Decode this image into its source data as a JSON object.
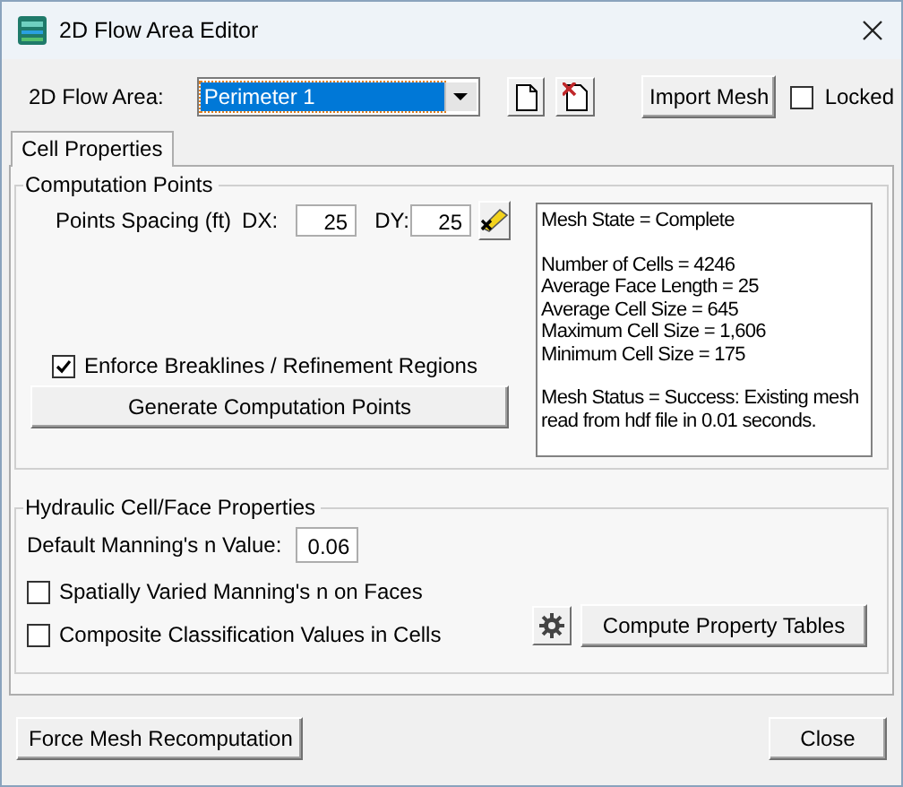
{
  "window": {
    "title": "2D Flow Area Editor"
  },
  "flow_area": {
    "label": "2D Flow Area:",
    "value": "Perimeter 1"
  },
  "import_button": "Import Mesh",
  "locked": {
    "label": "Locked",
    "checked": false
  },
  "tabs": [
    {
      "label": "Cell Properties",
      "selected": true
    }
  ],
  "computation_points": {
    "title": "Computation Points",
    "spacing_label": "Points Spacing (ft)",
    "dx_label": "DX:",
    "dx_value": "25",
    "dy_label": "DY:",
    "dy_value": "25",
    "enforce": {
      "label": "Enforce Breaklines / Refinement Regions",
      "checked": true
    },
    "generate_button": "Generate Computation Points",
    "mesh_info": [
      [
        "Mesh State = Complete"
      ],
      [
        "Number of Cells = 4246",
        "Average Face Length = 25",
        "Average Cell Size = 645",
        "Maximum Cell Size = 1,606",
        "Minimum Cell Size = 175"
      ],
      [
        "Mesh Status = Success: Existing mesh read from hdf file in 0.01 seconds."
      ]
    ]
  },
  "hydraulic": {
    "title": "Hydraulic Cell/Face Properties",
    "mannings_label": "Default Manning's n Value:",
    "mannings_value": "0.06",
    "options": [
      {
        "label": "Spatially Varied Manning's n on Faces",
        "checked": false
      },
      {
        "label": "Composite Classification Values in Cells",
        "checked": false
      }
    ],
    "compute_button": "Compute Property Tables"
  },
  "force_button": "Force Mesh Recomputation",
  "close_button": "Close"
}
